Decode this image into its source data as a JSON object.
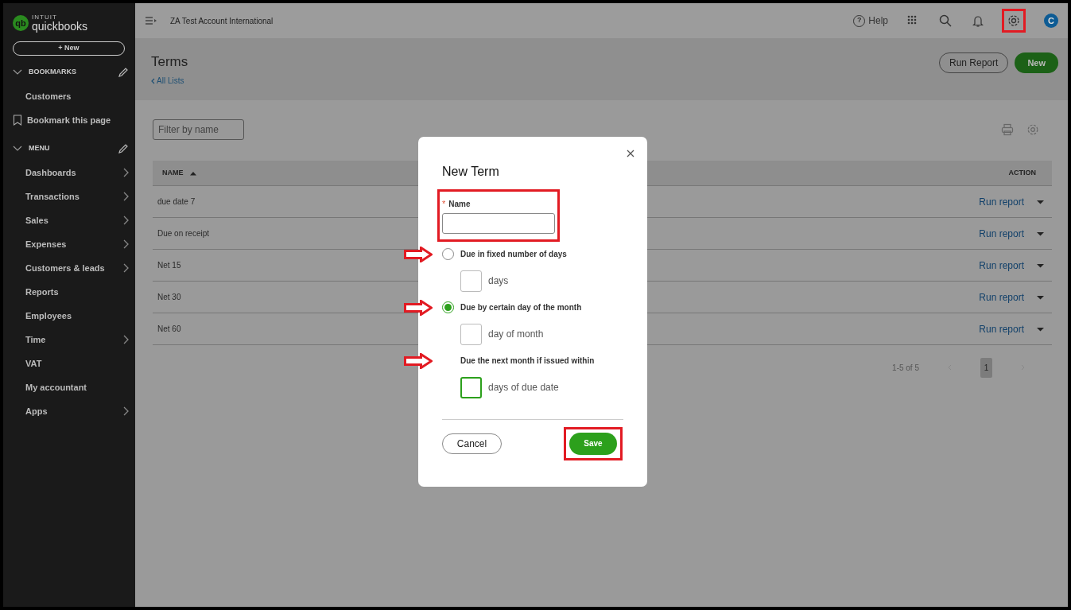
{
  "sidebar": {
    "logo_mark": "qb",
    "logo_top": "INTUIT",
    "logo": "quickbooks",
    "new_button": "+ New",
    "sections": [
      {
        "title": "BOOKMARKS",
        "expanded": true,
        "items": [
          {
            "label": "Customers",
            "kind": "link"
          },
          {
            "label": "Bookmark this page",
            "kind": "bookmark"
          }
        ]
      },
      {
        "title": "MENU",
        "expanded": true,
        "items": [
          {
            "label": "Dashboards",
            "kind": "submenu"
          },
          {
            "label": "Transactions",
            "kind": "submenu"
          },
          {
            "label": "Sales",
            "kind": "submenu"
          },
          {
            "label": "Expenses",
            "kind": "submenu"
          },
          {
            "label": "Customers & leads",
            "kind": "submenu"
          },
          {
            "label": "Reports",
            "kind": "link"
          },
          {
            "label": "Employees",
            "kind": "link"
          },
          {
            "label": "Time",
            "kind": "submenu"
          },
          {
            "label": "VAT",
            "kind": "link"
          },
          {
            "label": "My accountant",
            "kind": "link"
          },
          {
            "label": "Apps",
            "kind": "submenu"
          }
        ]
      }
    ]
  },
  "topbar": {
    "company": "ZA Test Account International",
    "help_glyph": "?",
    "help": "Help",
    "settings_highlighted": true,
    "avatar": "C"
  },
  "page": {
    "title": "Terms",
    "back_link": "All Lists",
    "run_report": "Run Report",
    "new": "New"
  },
  "filter": {
    "placeholder": "Filter by name"
  },
  "table": {
    "columns": [
      "NAME",
      "ACTION"
    ],
    "rows": [
      {
        "name": "due date 7",
        "action": "Run report"
      },
      {
        "name": "Due on receipt",
        "action": "Run report"
      },
      {
        "name": "Net 15",
        "action": "Run report"
      },
      {
        "name": "Net 30",
        "action": "Run report"
      },
      {
        "name": "Net 60",
        "action": "Run report"
      }
    ]
  },
  "pagination": {
    "range": "1-5 of 5",
    "pages": [
      {
        "label": "1",
        "selected": true
      }
    ]
  },
  "dialog": {
    "title": "New Term",
    "name_label": "Name",
    "required_mark": "*",
    "name_highlighted": true,
    "options": [
      {
        "kind": "radio",
        "label": "Due in fixed number of days",
        "selected": false,
        "arrow": true,
        "suffix": "days",
        "focused": false
      },
      {
        "kind": "radio",
        "label": "Due by certain day of the month",
        "selected": true,
        "arrow": true,
        "suffix": "day of month",
        "focused": false
      },
      {
        "kind": "plain",
        "label": "Due the next month if issued within",
        "arrow": true,
        "suffix": "days of due date",
        "focused": true
      }
    ],
    "cancel": "Cancel",
    "save": "Save",
    "save_highlighted": true
  }
}
